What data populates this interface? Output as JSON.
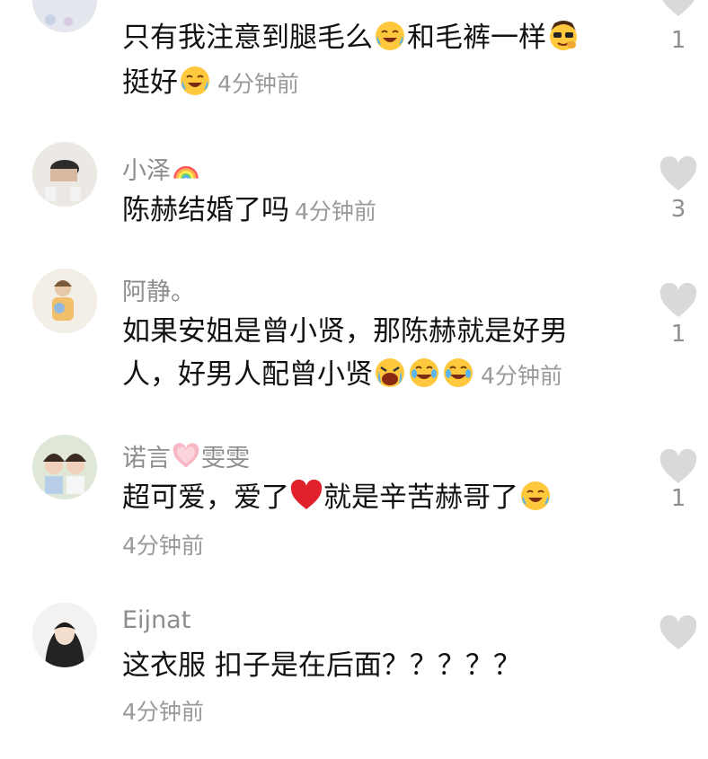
{
  "comments": [
    {
      "username": "",
      "line1": "只有我注意到腿毛么",
      "line1_mid": "和毛裤一样",
      "line2": "挺好",
      "time": "4分钟前",
      "likes": "1"
    },
    {
      "username": "小泽",
      "username_icon": "rainbow-icon",
      "text": "陈赫结婚了吗",
      "time": "4分钟前",
      "likes": "3"
    },
    {
      "username": "阿静。",
      "line1": "如果安姐是曾小贤，那陈赫就是好男",
      "line2": "人，好男人配曾小贤",
      "time": "4分钟前",
      "likes": "1"
    },
    {
      "username_a": "诺言",
      "username_icon": "pink-heart-icon",
      "username_b": "雯雯",
      "text_a": "超可爱，爱了",
      "text_b": "就是辛苦赫哥了",
      "time": "4分钟前",
      "likes": "1"
    },
    {
      "username": "Eijnat",
      "text": "这衣服 扣子是在后面？？？？？",
      "time": "4分钟前",
      "likes": ""
    }
  ],
  "colors": {
    "username": "#8d8d8d",
    "text": "#111111",
    "time": "#9a9a9a",
    "heart": "#d9d9d9",
    "red_heart": "#e0202b"
  }
}
